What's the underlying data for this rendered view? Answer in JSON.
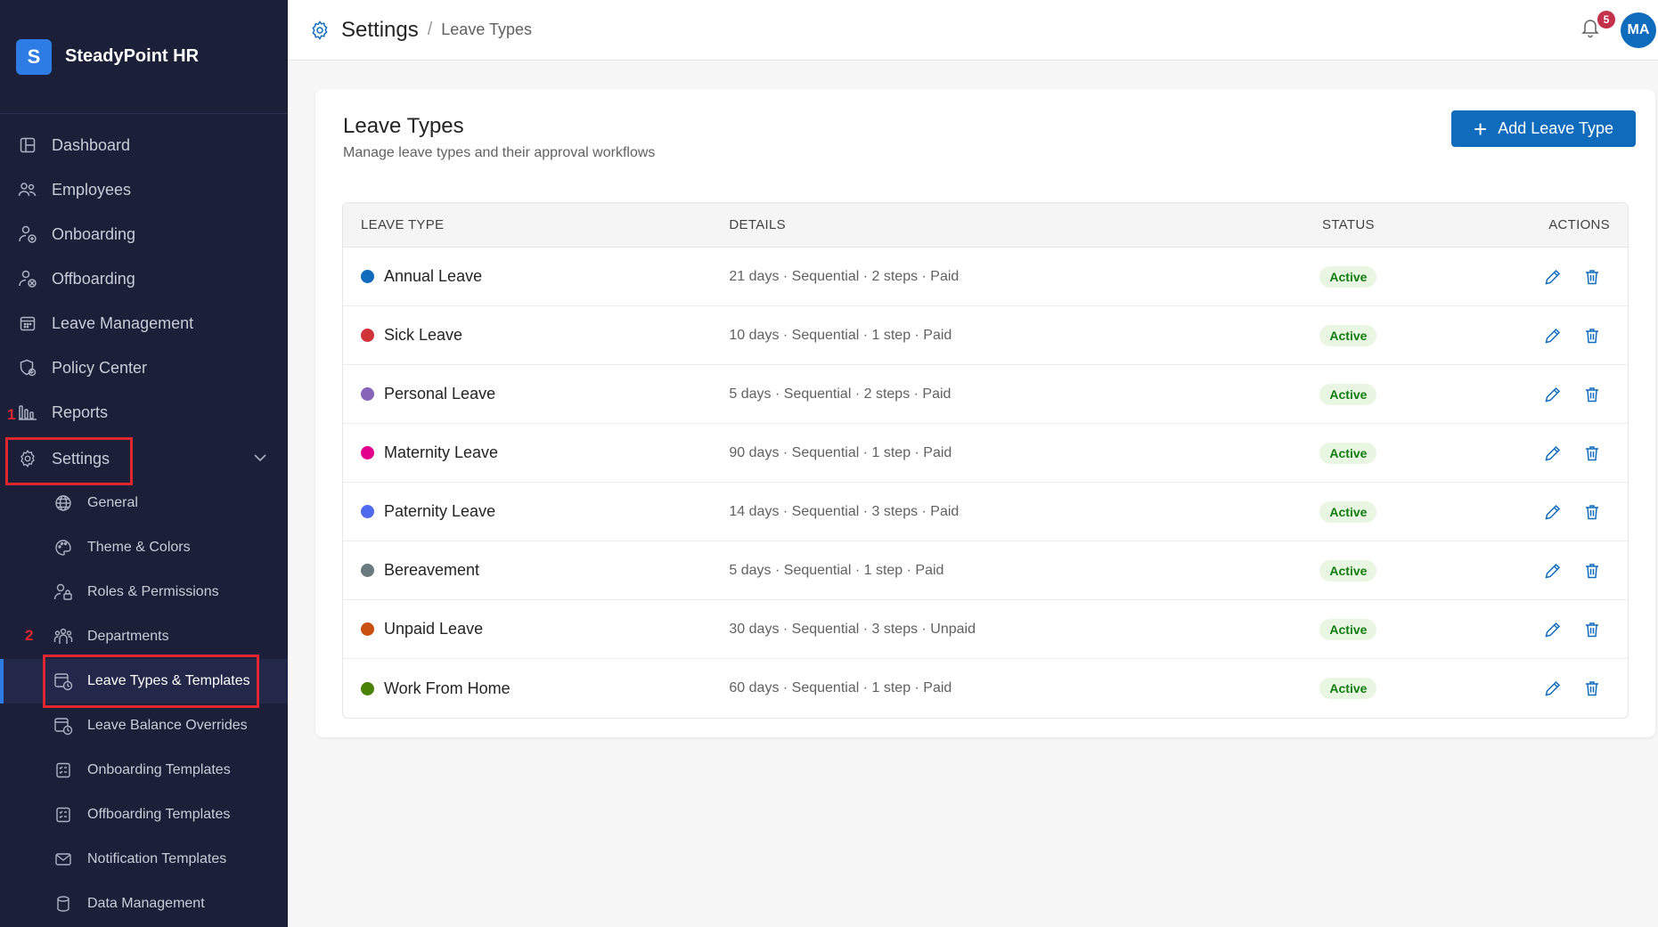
{
  "brand": {
    "logo_letter": "S",
    "name": "SteadyPoint HR"
  },
  "colors": {
    "sidebar_bg": "#1b1f38",
    "accent": "#0f6cbd",
    "highlight_box": "#e0262f",
    "status_active_bg": "#e9f6e2",
    "status_active_fg": "#107c10"
  },
  "sidebar": {
    "items": [
      {
        "label": "Dashboard",
        "icon": "dashboard-icon"
      },
      {
        "label": "Employees",
        "icon": "people-icon"
      },
      {
        "label": "Onboarding",
        "icon": "person-add-icon"
      },
      {
        "label": "Offboarding",
        "icon": "person-remove-icon"
      },
      {
        "label": "Leave Management",
        "icon": "calendar-icon"
      },
      {
        "label": "Policy Center",
        "icon": "shield-icon"
      },
      {
        "label": "Reports",
        "icon": "bar-chart-icon"
      }
    ],
    "settings": {
      "label": "Settings",
      "icon": "gear-icon",
      "expanded_icon": "chevron-down-icon"
    },
    "settings_children": [
      {
        "label": "General",
        "icon": "globe-icon"
      },
      {
        "label": "Theme & Colors",
        "icon": "palette-icon"
      },
      {
        "label": "Roles & Permissions",
        "icon": "person-lock-icon"
      },
      {
        "label": "Departments",
        "icon": "people-team-icon"
      },
      {
        "label": "Leave Types & Templates",
        "icon": "calendar-clock-icon",
        "active": true
      },
      {
        "label": "Leave Balance Overrides",
        "icon": "calendar-clock-icon"
      },
      {
        "label": "Onboarding Templates",
        "icon": "template-icon"
      },
      {
        "label": "Offboarding Templates",
        "icon": "template-icon"
      },
      {
        "label": "Notification Templates",
        "icon": "mail-icon"
      },
      {
        "label": "Data Management",
        "icon": "database-icon"
      }
    ],
    "annotations": {
      "marker_1": "1",
      "marker_2": "2"
    }
  },
  "header": {
    "title": "Settings",
    "separator": "/",
    "subtitle": "Leave Types",
    "notifications_count": "5",
    "avatar_initials": "MA"
  },
  "card": {
    "title": "Leave Types",
    "subtitle": "Manage leave types and their approval workflows",
    "add_button_label": "Add Leave Type"
  },
  "table": {
    "columns": [
      "LEAVE TYPE",
      "DETAILS",
      "STATUS",
      "ACTIONS"
    ],
    "rows": [
      {
        "name": "Annual Leave",
        "color": "#0f6cbd",
        "details": "21 days · Sequential · 2 steps · Paid",
        "status": "Active"
      },
      {
        "name": "Sick Leave",
        "color": "#d13438",
        "details": "10 days · Sequential · 1 step · Paid",
        "status": "Active"
      },
      {
        "name": "Personal Leave",
        "color": "#8764b8",
        "details": "5 days · Sequential · 2 steps · Paid",
        "status": "Active"
      },
      {
        "name": "Maternity Leave",
        "color": "#e3008c",
        "details": "90 days · Sequential · 1 step · Paid",
        "status": "Active"
      },
      {
        "name": "Paternity Leave",
        "color": "#4f6bed",
        "details": "14 days · Sequential · 3 steps · Paid",
        "status": "Active"
      },
      {
        "name": "Bereavement",
        "color": "#69797e",
        "details": "5 days · Sequential · 1 step · Paid",
        "status": "Active"
      },
      {
        "name": "Unpaid Leave",
        "color": "#ca5010",
        "details": "30 days · Sequential · 3 steps · Unpaid",
        "status": "Active"
      },
      {
        "name": "Work From Home",
        "color": "#498205",
        "details": "60 days · Sequential · 1 step · Paid",
        "status": "Active"
      }
    ]
  }
}
